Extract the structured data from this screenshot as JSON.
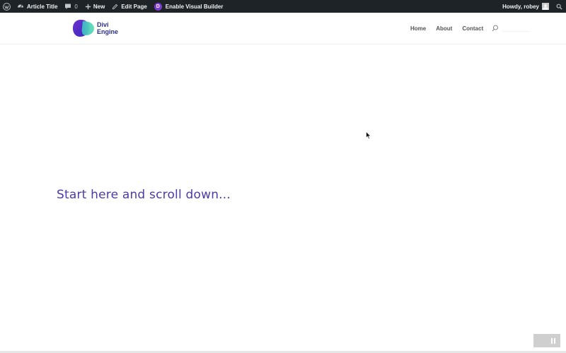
{
  "admin_bar": {
    "site_title": "Article Title",
    "comments_count": "0",
    "new_label": "New",
    "edit_label": "Edit Page",
    "divi_label": "Enable Visual Builder",
    "divi_badge": "D",
    "greeting": "Howdy, robey"
  },
  "header": {
    "logo_line1": "Divi",
    "logo_line2": "Engine",
    "nav": [
      "Home",
      "About",
      "Contact"
    ],
    "search_placeholder": ""
  },
  "content": {
    "heading": "Start here and scroll down..."
  },
  "colors": {
    "admin_bar_bg": "#1d2327",
    "accent": "#4d3aaa",
    "divi_purple": "#7e3bd0"
  }
}
